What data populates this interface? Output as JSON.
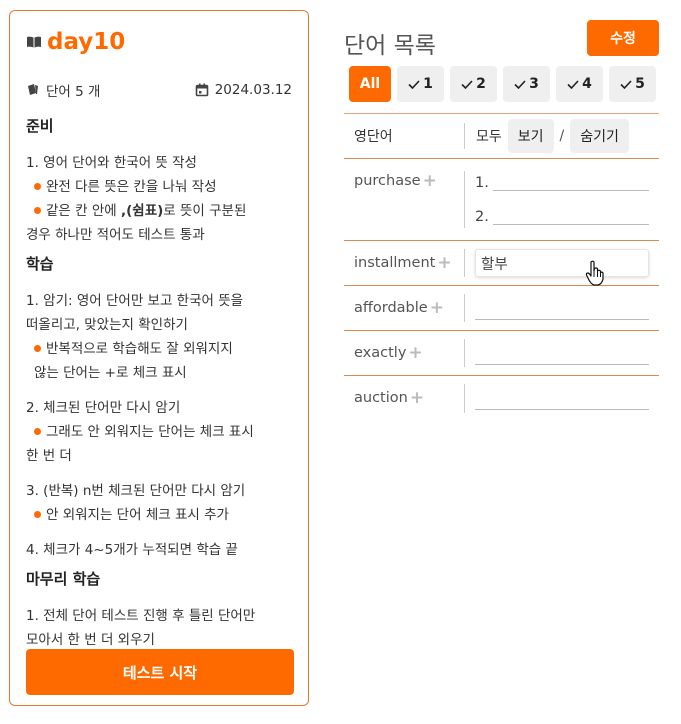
{
  "card": {
    "title": "day10",
    "word_count": "단어 5 개",
    "date": "2024.03.12",
    "sections": {
      "prep": {
        "title": "준비",
        "step1": "1. 영어 단어와 한국어 뜻 작성",
        "bullet1": "완전 다른 뜻은 칸을 나눠 작성",
        "bullet2_a": "같은 칸 안에 ",
        "bullet2_b": ",(쉼표)",
        "bullet2_c": "로 뜻이 구분된",
        "bullet2_line2": "경우 하나만 적어도 테스트 통과"
      },
      "study": {
        "title": "학습",
        "step1_line1": "1. 암기: 영어 단어만 보고 한국어 뜻을",
        "step1_line2": "떠올리고, 맞았는지 확인하기",
        "step1_bullet_line1": "반복적으로 학습해도 잘 외워지지",
        "step1_bullet_line2": "않는 단어는 +로 체크 표시",
        "step2": "2. 체크된 단어만 다시 암기",
        "step2_bullet_line1": "그래도 안 외워지는 단어는 체크 표시",
        "step2_bullet_line2": "한 번 더",
        "step3": "3. (반복) n번 체크된 단어만 다시 암기",
        "step3_bullet": "안 외워지는 단어 체크 표시 추가",
        "step4": "4. 체크가 4~5개가 누적되면 학습 끝"
      },
      "wrapup": {
        "title": "마무리 학습",
        "step1_line1": "1. 전체 단어 테스트 진행 후 틀린 단어만",
        "step1_line2": "모아서 한 번 더 외우기"
      }
    },
    "start_button": "테스트 시작"
  },
  "panel": {
    "title": "단어 목록",
    "edit_button": "수정",
    "filters": {
      "all": "All",
      "checks": [
        "1",
        "2",
        "3",
        "4",
        "5"
      ]
    },
    "table": {
      "col_word": "영단어",
      "col_meaning_label": "모두",
      "show_button": "보기",
      "separator": "/",
      "hide_button": "숨기기",
      "plus": "+",
      "rows": [
        {
          "word": "purchase",
          "meanings": [
            "1.",
            "2."
          ]
        },
        {
          "word": "installment",
          "answer": "할부"
        },
        {
          "word": "affordable"
        },
        {
          "word": "exactly"
        },
        {
          "word": "auction"
        }
      ]
    }
  },
  "colors": {
    "accent": "#ff6a00",
    "border": "#e07a35",
    "button_gray": "#efefef"
  },
  "icons": [
    "book-icon",
    "cards-icon",
    "calendar-icon",
    "check-icon",
    "plus-icon",
    "hand-pointer-icon"
  ]
}
